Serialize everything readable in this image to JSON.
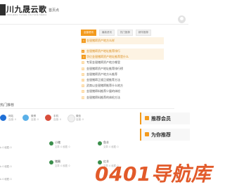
{
  "header": {
    "logo_text": "川九晟云歌",
    "logo_sub": "JIUCHENG YUNGE CULTURE MEDIA",
    "nav_home": "首页点"
  },
  "tabs": [
    {
      "label": "全部资讯",
      "active": true
    },
    {
      "label": "最新资讯",
      "active": false
    },
    {
      "label": "热门推荐",
      "active": false
    },
    {
      "label": "精华推荐",
      "active": false
    }
  ],
  "articles": [
    {
      "num": "1",
      "title": "金银猪蹄资产地方么样",
      "style": "big"
    },
    {
      "num": "2",
      "title": "金银猪蹄资产地址推荐排行",
      "style": "hl"
    },
    {
      "num": "3",
      "title": "华亿金银猪蹄资产地址推荐是什么",
      "style": "mid"
    },
    {
      "num": "4",
      "title": "专家金银猪蹄资产地方哪里",
      "style": ""
    },
    {
      "num": "5",
      "title": "金银猪蹄资产地址推荐排行榜",
      "style": ""
    },
    {
      "num": "6",
      "title": "金银猪蹄资产地方么推荐",
      "style": ""
    },
    {
      "num": "7",
      "title": "金银猪蹄正规正规推荐方法",
      "style": ""
    },
    {
      "num": "8",
      "title": "武商以金银猪蹄推荐什么地方",
      "style": ""
    },
    {
      "num": "9",
      "title": "金银猪蹄料推荐少量的体检",
      "style": ""
    },
    {
      "num": "10",
      "title": "金银猪蹄料推荐的体检方法",
      "style": ""
    }
  ],
  "section_label": "热门推荐",
  "mini_cards": [
    {
      "name": "网站",
      "value": "百度: 0",
      "color": "#1f6fd6"
    },
    {
      "name": "微博",
      "value": "百度: 0",
      "color": "#5ab0e8"
    },
    {
      "name": "手机",
      "value": "百度: 0",
      "color": "#d84d3b"
    },
    {
      "name": "微信",
      "value": "百度: 0",
      "color": "#f0f0f0"
    }
  ],
  "sidebar": [
    {
      "label": "推荐会员"
    },
    {
      "label": "为你推荐"
    }
  ],
  "grid": [
    {
      "name": "小猪",
      "meta": "文章: 0  收藏: 0"
    },
    {
      "name": "鱼羊",
      "meta": "文章: 0  收藏: 0"
    },
    {
      "name": "猪圈",
      "meta": "文章: 0  收藏: 0"
    },
    {
      "name": "红羊",
      "meta": "文章: 0  收藏: 0"
    }
  ],
  "left_meta": [
    "k: 0  收藏: 0",
    "k: 0  收藏: 0",
    "k: 0  收藏: 0"
  ],
  "watermark": "0401导航库"
}
